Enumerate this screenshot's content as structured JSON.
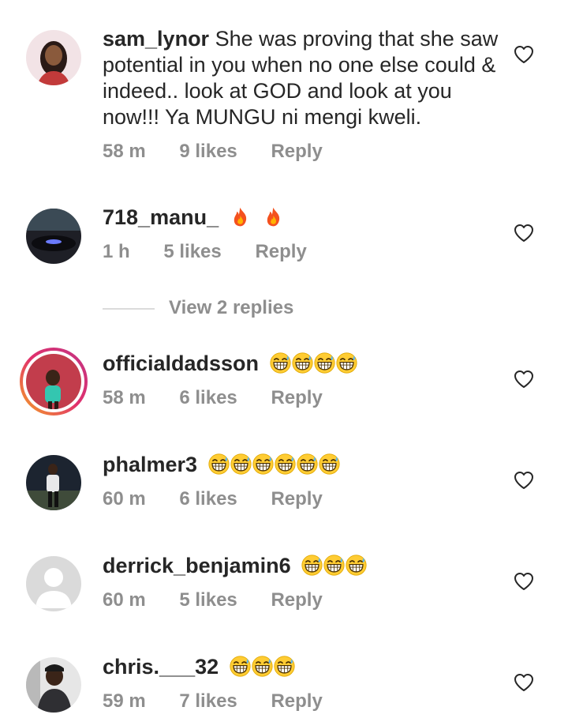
{
  "comments": [
    {
      "username": "sam_lynor",
      "text": "She was proving that she saw potential in you when no one else could & indeed.. look at GOD and look at you now!!! Ya MUNGU ni mengi kweli.",
      "time": "58 m",
      "likes": "9 likes",
      "reply": "Reply",
      "emojis": ""
    },
    {
      "username": "718_manu_",
      "text": "",
      "time": "1 h",
      "likes": "5 likes",
      "reply": "Reply",
      "emojis": "fire x2"
    },
    {
      "username": "officialdadsson",
      "text": "",
      "time": "58 m",
      "likes": "6 likes",
      "reply": "Reply",
      "emojis": "grin-sweat x4"
    },
    {
      "username": "phalmer3",
      "text": "",
      "time": "60 m",
      "likes": "6 likes",
      "reply": "Reply",
      "emojis": "grin-sweat x6"
    },
    {
      "username": "derrick_benjamin6",
      "text": "",
      "time": "60 m",
      "likes": "5 likes",
      "reply": "Reply",
      "emojis": "grin-sweat x3"
    },
    {
      "username": "chris.___32",
      "text": "",
      "time": "59 m",
      "likes": "7 likes",
      "reply": "Reply",
      "emojis": "grin-sweat x3"
    }
  ],
  "view_replies": "View 2 replies",
  "icons": {
    "heart": "heart-outline-icon",
    "fire": "fire-emoji",
    "grin": "grinning-sweat-emoji"
  },
  "colors": {
    "text": "#262626",
    "meta": "#8e8e8e",
    "divider": "#dbdbdb"
  }
}
